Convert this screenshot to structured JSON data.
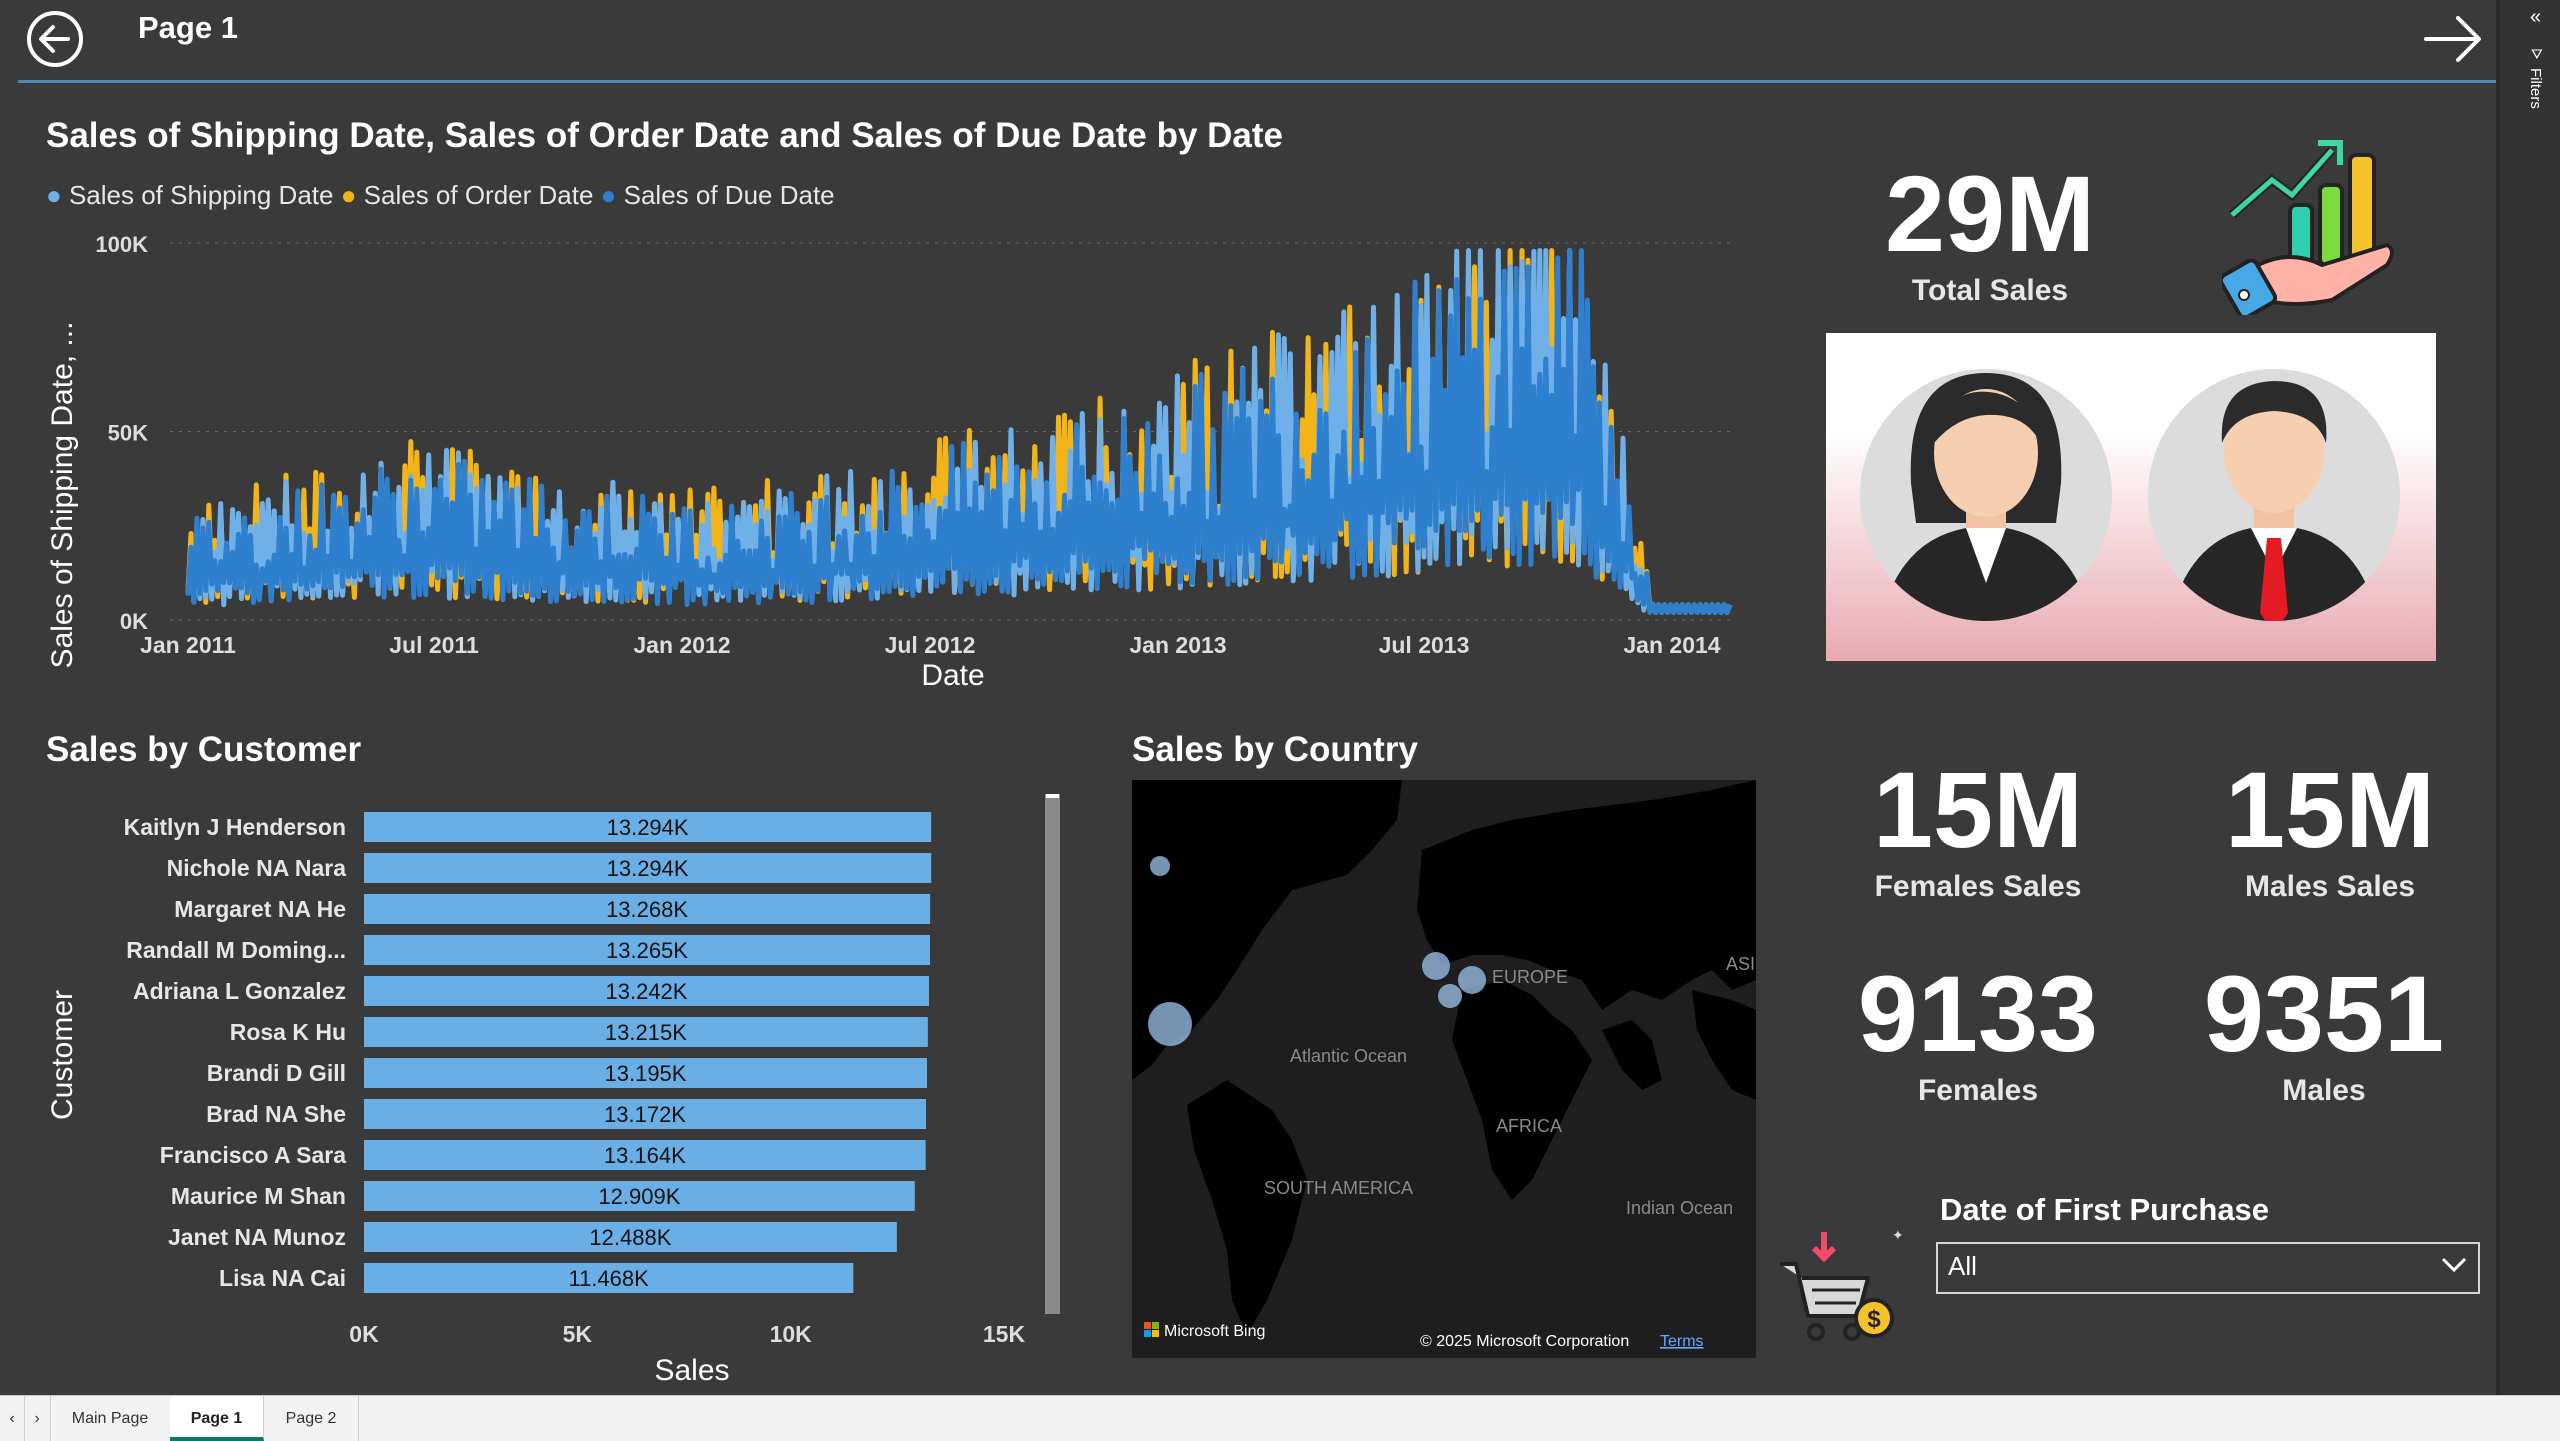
{
  "header": {
    "page_title": "Page 1",
    "back_icon": "back-arrow-icon",
    "next_icon": "forward-arrow-icon"
  },
  "right_pane": {
    "label": "Filters",
    "collapse_icon": "double-chevron-left-icon",
    "filter_icon": "funnel-icon"
  },
  "line_visual": {
    "title": "Sales of Shipping Date, Sales of Order Date and Sales of Due Date by Date",
    "legend": [
      "Sales of Shipping Date",
      "Sales of Order Date",
      "Sales of Due Date"
    ],
    "colors": {
      "shipping": "#6fb0e8",
      "order": "#f2b418",
      "due": "#2f7fcf"
    }
  },
  "bar_visual": {
    "title": "Sales by Customer"
  },
  "map_visual": {
    "title": "Sales by Country",
    "labels": {
      "europe": "EUROPE",
      "asia": "ASI",
      "atlantic": "Atlantic Ocean",
      "africa": "AFRICA",
      "south_america": "SOUTH AMERICA",
      "indian": "Indian Ocean"
    },
    "attribution": "Microsoft Bing",
    "copyright": "© 2025 Microsoft Corporation",
    "terms": "Terms"
  },
  "kpis": {
    "total_sales": {
      "value": "29M",
      "label": "Total Sales"
    },
    "female_sales": {
      "value": "15M",
      "label": "Females Sales"
    },
    "male_sales": {
      "value": "15M",
      "label": "Males Sales"
    },
    "females": {
      "value": "9133",
      "label": "Females"
    },
    "males": {
      "value": "9351",
      "label": "Males"
    }
  },
  "icons": {
    "growth": "growth-chart-hand-icon",
    "cart": "shopping-cart-dollar-icon",
    "female": "female-avatar-icon",
    "male": "male-avatar-icon"
  },
  "slicer": {
    "title": "Date of First Purchase",
    "value": "All"
  },
  "tabs": [
    "Main Page",
    "Page 1",
    "Page 2"
  ],
  "active_tab": "Page 1",
  "chart_data": [
    {
      "type": "line",
      "title": "Sales of Shipping Date, Sales of Order Date and Sales of Due Date by Date",
      "xlabel": "Date",
      "ylabel": "Sales of Shipping Date, ...",
      "x_ticks": [
        "Jan 2011",
        "Jul 2011",
        "Jan 2012",
        "Jul 2012",
        "Jan 2013",
        "Jul 2013",
        "Jan 2014"
      ],
      "y_ticks": [
        "0K",
        "50K",
        "100K"
      ],
      "ylim": [
        0,
        100000
      ],
      "x_range": [
        "Jan 2011",
        "Feb 2014"
      ],
      "grid": true,
      "legend_position": "top-left",
      "series": [
        {
          "name": "Sales of Shipping Date",
          "x": [
            "Jan 2011",
            "Mar 2011",
            "May 2011",
            "Jul 2011",
            "Sep 2011",
            "Nov 2011",
            "Jan 2012",
            "Mar 2012",
            "May 2012",
            "Jul 2012",
            "Sep 2012",
            "Nov 2012",
            "Jan 2013",
            "Mar 2013",
            "May 2013",
            "Jul 2013",
            "Sep 2013",
            "Nov 2013",
            "Dec 2013",
            "Jan 2014",
            "Feb 2014"
          ],
          "values": [
            15000,
            18000,
            21000,
            24000,
            22000,
            20000,
            18000,
            17000,
            19000,
            22000,
            25000,
            27000,
            30000,
            34000,
            38000,
            44000,
            48000,
            55000,
            60000,
            3000,
            3000
          ]
        },
        {
          "name": "Sales of Order Date",
          "x": [
            "Jan 2011",
            "Mar 2011",
            "May 2011",
            "Jul 2011",
            "Sep 2011",
            "Nov 2011",
            "Jan 2012",
            "Mar 2012",
            "May 2012",
            "Jul 2012",
            "Sep 2012",
            "Nov 2012",
            "Jan 2013",
            "Mar 2013",
            "May 2013",
            "Jul 2013",
            "Sep 2013",
            "Nov 2013",
            "Dec 2013",
            "Jan 2014",
            "Feb 2014"
          ],
          "values": [
            16000,
            19000,
            22000,
            25000,
            22000,
            21000,
            18000,
            18000,
            20000,
            23000,
            26000,
            28000,
            31000,
            35000,
            40000,
            46000,
            50000,
            57000,
            62000,
            3000,
            3000
          ]
        },
        {
          "name": "Sales of Due Date",
          "x": [
            "Jan 2011",
            "Mar 2011",
            "May 2011",
            "Jul 2011",
            "Sep 2011",
            "Nov 2011",
            "Jan 2012",
            "Mar 2012",
            "May 2012",
            "Jul 2012",
            "Sep 2012",
            "Nov 2012",
            "Jan 2013",
            "Mar 2013",
            "May 2013",
            "Jul 2013",
            "Sep 2013",
            "Nov 2013",
            "Dec 2013",
            "Jan 2014",
            "Feb 2014"
          ],
          "values": [
            14000,
            17000,
            20000,
            23000,
            21000,
            19000,
            17000,
            16000,
            18000,
            21000,
            24000,
            26000,
            29000,
            33000,
            37000,
            43000,
            47000,
            54000,
            58000,
            3000,
            3000
          ]
        }
      ]
    },
    {
      "type": "bar",
      "orientation": "horizontal",
      "title": "Sales by Customer",
      "xlabel": "Sales",
      "ylabel": "Customer",
      "x_ticks": [
        "0K",
        "5K",
        "10K",
        "15K"
      ],
      "xlim": [
        0,
        15000
      ],
      "categories": [
        "Kaitlyn J Henderson",
        "Nichole NA Nara",
        "Margaret NA He",
        "Randall M Doming...",
        "Adriana L Gonzalez",
        "Rosa K Hu",
        "Brandi D Gill",
        "Brad NA She",
        "Francisco A Sara",
        "Maurice M Shan",
        "Janet NA Munoz",
        "Lisa NA Cai"
      ],
      "values": [
        13294,
        13294,
        13268,
        13265,
        13242,
        13215,
        13195,
        13172,
        13164,
        12909,
        12488,
        11468
      ],
      "data_labels": [
        "13.294K",
        "13.294K",
        "13.268K",
        "13.265K",
        "13.242K",
        "13.215K",
        "13.195K",
        "13.172K",
        "13.164K",
        "12.909K",
        "12.488K",
        "11.468K"
      ],
      "color": "#6aaee6"
    },
    {
      "type": "scatter",
      "title": "Sales by Country",
      "note": "bubble map",
      "series": [
        {
          "name": "Sales",
          "points": [
            {
              "region": "north-america-west",
              "size": 1
            },
            {
              "region": "north-america-south",
              "size": 4
            },
            {
              "region": "europe-1",
              "size": 1.5
            },
            {
              "region": "europe-2",
              "size": 1.4
            },
            {
              "region": "europe-3",
              "size": 1.2
            }
          ]
        }
      ]
    }
  ]
}
